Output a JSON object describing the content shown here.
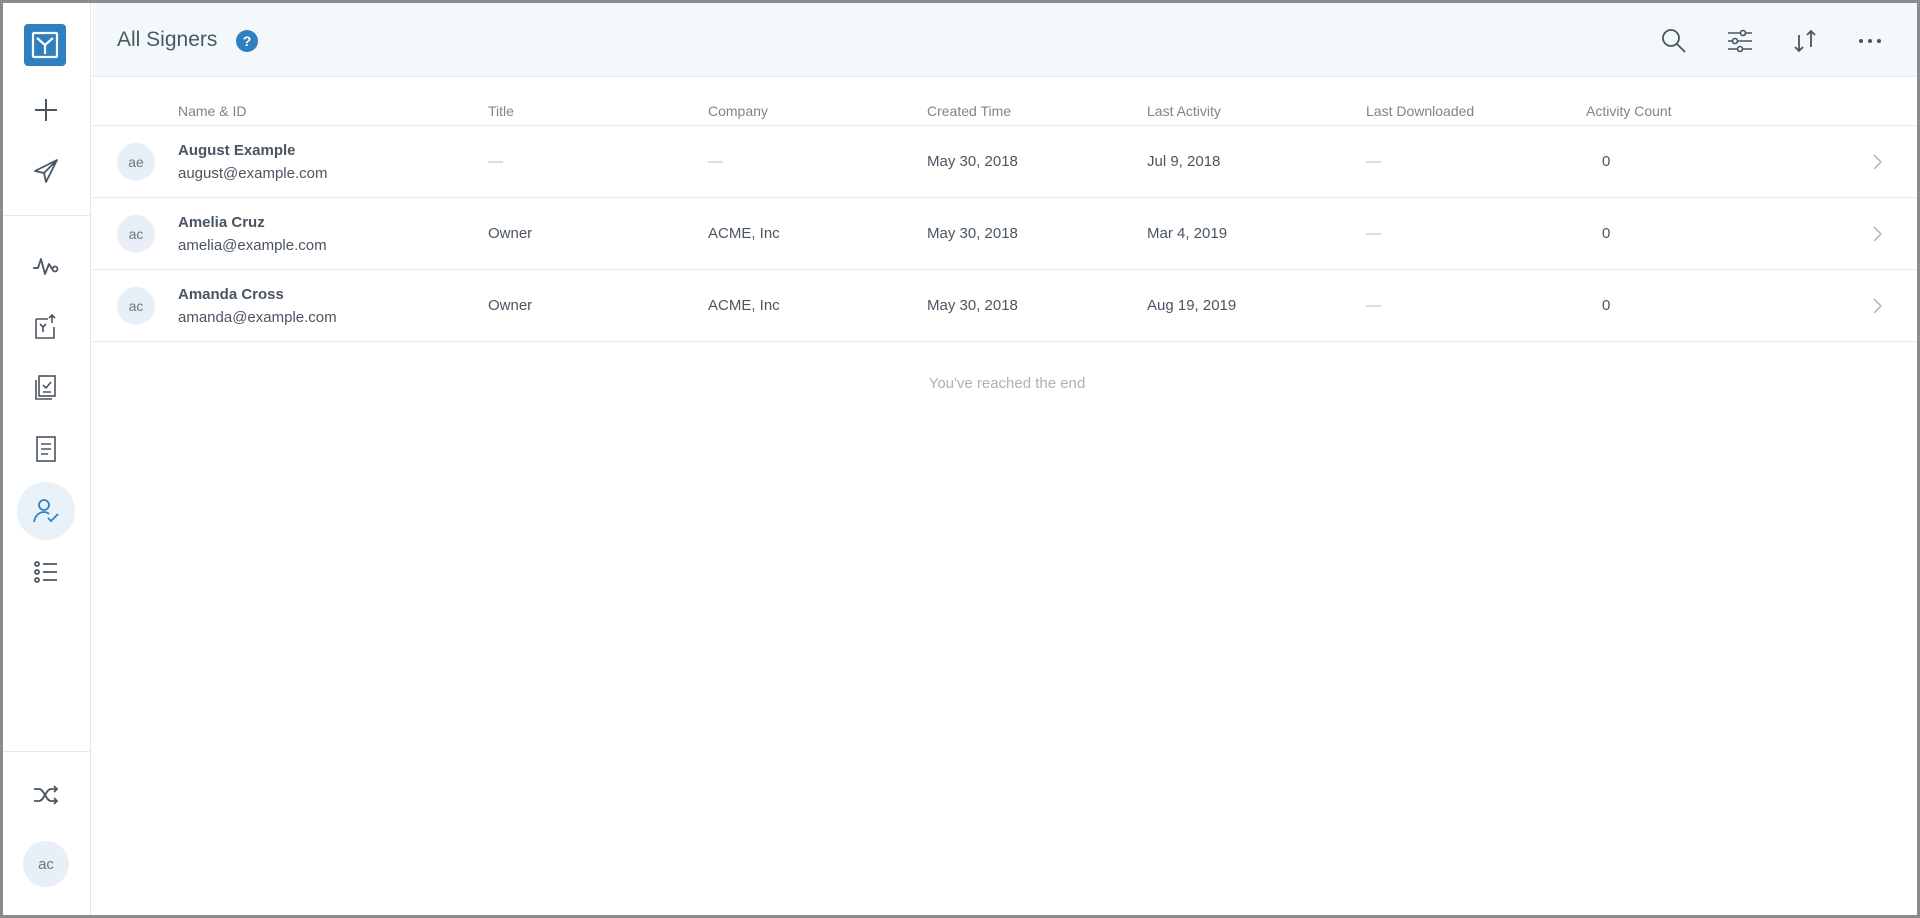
{
  "header": {
    "title": "All Signers",
    "help_glyph": "?"
  },
  "sidebar": {
    "items": [
      {
        "name": "logo-icon"
      },
      {
        "name": "plus-icon"
      },
      {
        "name": "send-icon"
      },
      {
        "name": "activity-icon"
      },
      {
        "name": "document-upload-icon"
      },
      {
        "name": "documents-check-icon"
      },
      {
        "name": "template-icon"
      },
      {
        "name": "signer-check-icon",
        "active": true
      },
      {
        "name": "list-icon"
      },
      {
        "name": "shuffle-icon"
      }
    ],
    "user_initials": "ac"
  },
  "table": {
    "columns": [
      "Name & ID",
      "Title",
      "Company",
      "Created Time",
      "Last Activity",
      "Last Downloaded",
      "Activity Count"
    ],
    "rows": [
      {
        "initials": "ae",
        "name": "August Example",
        "email": "august@example.com",
        "title": "—",
        "company": "—",
        "created": "May 30, 2018",
        "last_activity": "Jul 9, 2018",
        "last_downloaded": "—",
        "count": "0"
      },
      {
        "initials": "ac",
        "name": "Amelia Cruz",
        "email": "amelia@example.com",
        "title": "Owner",
        "company": "ACME, Inc",
        "created": "May 30, 2018",
        "last_activity": "Mar 4, 2019",
        "last_downloaded": "—",
        "count": "0"
      },
      {
        "initials": "ac",
        "name": "Amanda Cross",
        "email": "amanda@example.com",
        "title": "Owner",
        "company": "ACME, Inc",
        "created": "May 30, 2018",
        "last_activity": "Aug 19, 2019",
        "last_downloaded": "—",
        "count": "0"
      }
    ]
  },
  "end_note": "You've reached the end",
  "colors": {
    "accent": "#2f80c0",
    "header_bg": "#f3f8fb",
    "active_bg": "#e9f1f8"
  }
}
